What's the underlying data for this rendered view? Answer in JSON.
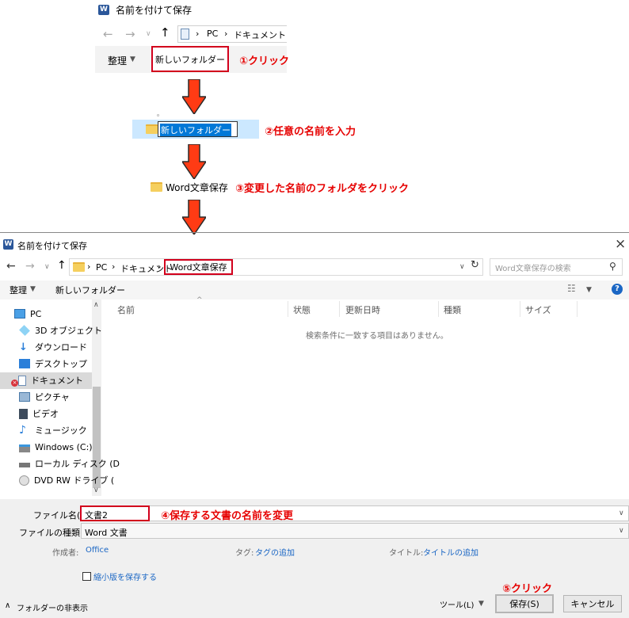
{
  "top": {
    "title": "名前を付けて保存",
    "breadcrumb": [
      "PC",
      "ドキュメント"
    ],
    "organize": "整理",
    "new_folder": "新しいフォルダー",
    "step1": "①クリック"
  },
  "step2": {
    "folder_edit_value": "新しいフォルダー",
    "label": "②任意の名前を入力",
    "partial_item": "。"
  },
  "step3": {
    "folder_name": "Word文章保存",
    "label": "③変更した名前のフォルダをクリック"
  },
  "dialog": {
    "title": "名前を付けて保存",
    "close": "×",
    "breadcrumb": [
      "PC",
      "ドキュメント",
      "Word文章保存"
    ],
    "search_placeholder": "Word文章保存の検索",
    "organize": "整理",
    "new_folder": "新しいフォルダー",
    "columns": [
      "名前",
      "状態",
      "更新日時",
      "種類",
      "サイズ"
    ],
    "empty_message": "検索条件に一致する項目はありません。",
    "sidebar": [
      {
        "label": "PC",
        "icon": "pc-icon"
      },
      {
        "label": "3D オブジェクト",
        "icon": "cube-icon"
      },
      {
        "label": "ダウンロード",
        "icon": "download-icon"
      },
      {
        "label": "デスクトップ",
        "icon": "desktop-icon"
      },
      {
        "label": "ドキュメント",
        "icon": "document-icon"
      },
      {
        "label": "ピクチャ",
        "icon": "picture-icon"
      },
      {
        "label": "ビデオ",
        "icon": "video-icon"
      },
      {
        "label": "ミュージック",
        "icon": "music-icon"
      },
      {
        "label": "Windows (C:)",
        "icon": "drive-icon"
      },
      {
        "label": "ローカル ディスク (D",
        "icon": "disk-icon"
      },
      {
        "label": "DVD RW ドライブ (",
        "icon": "dvd-icon"
      }
    ],
    "filename_label": "ファイル名(N):",
    "filename_value": "文書2",
    "step4": "④保存する文書の名前を変更",
    "filetype_label": "ファイルの種類(T):",
    "filetype_value": "Word 文書",
    "author_label": "作成者:",
    "author_value": "Office",
    "tags_label": "タグ:",
    "tags_value": "タグの追加",
    "title_label": "タイトル:",
    "title_value": "タイトルの追加",
    "thumbnail_label": "縮小版を保存する",
    "hide_folders": "フォルダーの非表示",
    "tools": "ツール(L)",
    "save": "保存(S)",
    "cancel": "キャンセル",
    "step5": "⑤クリック"
  },
  "colors": {
    "accent_red": "#d2001c",
    "link_blue": "#1a66c4",
    "selection": "#cce8ff"
  }
}
